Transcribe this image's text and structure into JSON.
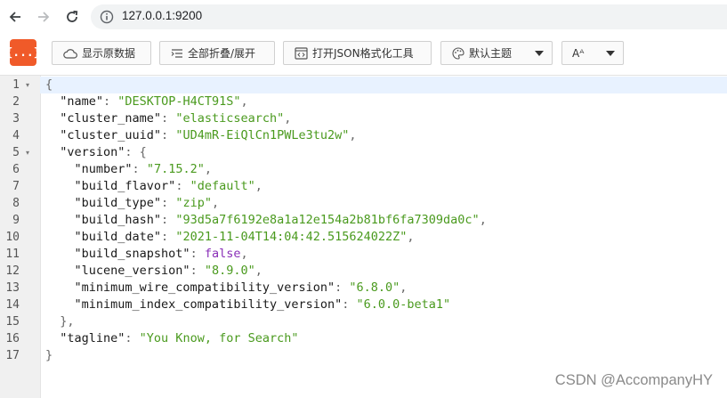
{
  "browser": {
    "url": "127.0.0.1:9200",
    "icons": [
      "arrow-left-icon",
      "arrow-right-icon",
      "reload-icon",
      "info-icon"
    ]
  },
  "toolbar": {
    "logo_text": "{...}",
    "show_raw_label": "显示原数据",
    "fold_all_label": "全部折叠/展开",
    "open_tool_label": "打开JSON格式化工具",
    "theme_label": "默认主题",
    "font_label": "Aᴬ"
  },
  "code": {
    "lines": [
      {
        "n": "1",
        "fold": "▾",
        "tokens": [
          {
            "t": "{",
            "c": "p"
          }
        ]
      },
      {
        "n": "2",
        "tokens": [
          {
            "t": "  \"name\"",
            "c": "k"
          },
          {
            "t": ": ",
            "c": "p"
          },
          {
            "t": "\"DESKTOP-H4CT91S\"",
            "c": "s"
          },
          {
            "t": ",",
            "c": "p"
          }
        ]
      },
      {
        "n": "3",
        "tokens": [
          {
            "t": "  \"cluster_name\"",
            "c": "k"
          },
          {
            "t": ": ",
            "c": "p"
          },
          {
            "t": "\"elasticsearch\"",
            "c": "s"
          },
          {
            "t": ",",
            "c": "p"
          }
        ]
      },
      {
        "n": "4",
        "tokens": [
          {
            "t": "  \"cluster_uuid\"",
            "c": "k"
          },
          {
            "t": ": ",
            "c": "p"
          },
          {
            "t": "\"UD4mR-EiQlCn1PWLe3tu2w\"",
            "c": "s"
          },
          {
            "t": ",",
            "c": "p"
          }
        ]
      },
      {
        "n": "5",
        "fold": "▾",
        "tokens": [
          {
            "t": "  \"version\"",
            "c": "k"
          },
          {
            "t": ": {",
            "c": "p"
          }
        ]
      },
      {
        "n": "6",
        "tokens": [
          {
            "t": "    \"number\"",
            "c": "k"
          },
          {
            "t": ": ",
            "c": "p"
          },
          {
            "t": "\"7.15.2\"",
            "c": "s"
          },
          {
            "t": ",",
            "c": "p"
          }
        ]
      },
      {
        "n": "7",
        "tokens": [
          {
            "t": "    \"build_flavor\"",
            "c": "k"
          },
          {
            "t": ": ",
            "c": "p"
          },
          {
            "t": "\"default\"",
            "c": "s"
          },
          {
            "t": ",",
            "c": "p"
          }
        ]
      },
      {
        "n": "8",
        "tokens": [
          {
            "t": "    \"build_type\"",
            "c": "k"
          },
          {
            "t": ": ",
            "c": "p"
          },
          {
            "t": "\"zip\"",
            "c": "s"
          },
          {
            "t": ",",
            "c": "p"
          }
        ]
      },
      {
        "n": "9",
        "tokens": [
          {
            "t": "    \"build_hash\"",
            "c": "k"
          },
          {
            "t": ": ",
            "c": "p"
          },
          {
            "t": "\"93d5a7f6192e8a1a12e154a2b81bf6fa7309da0c\"",
            "c": "s"
          },
          {
            "t": ",",
            "c": "p"
          }
        ]
      },
      {
        "n": "10",
        "tokens": [
          {
            "t": "    \"build_date\"",
            "c": "k"
          },
          {
            "t": ": ",
            "c": "p"
          },
          {
            "t": "\"2021-11-04T14:04:42.515624022Z\"",
            "c": "s"
          },
          {
            "t": ",",
            "c": "p"
          }
        ]
      },
      {
        "n": "11",
        "tokens": [
          {
            "t": "    \"build_snapshot\"",
            "c": "k"
          },
          {
            "t": ": ",
            "c": "p"
          },
          {
            "t": "false",
            "c": "b"
          },
          {
            "t": ",",
            "c": "p"
          }
        ]
      },
      {
        "n": "12",
        "tokens": [
          {
            "t": "    \"lucene_version\"",
            "c": "k"
          },
          {
            "t": ": ",
            "c": "p"
          },
          {
            "t": "\"8.9.0\"",
            "c": "s"
          },
          {
            "t": ",",
            "c": "p"
          }
        ]
      },
      {
        "n": "13",
        "tokens": [
          {
            "t": "    \"minimum_wire_compatibility_version\"",
            "c": "k"
          },
          {
            "t": ": ",
            "c": "p"
          },
          {
            "t": "\"6.8.0\"",
            "c": "s"
          },
          {
            "t": ",",
            "c": "p"
          }
        ]
      },
      {
        "n": "14",
        "tokens": [
          {
            "t": "    \"minimum_index_compatibility_version\"",
            "c": "k"
          },
          {
            "t": ": ",
            "c": "p"
          },
          {
            "t": "\"6.0.0-beta1\"",
            "c": "s"
          }
        ]
      },
      {
        "n": "15",
        "tokens": [
          {
            "t": "  },",
            "c": "p"
          }
        ]
      },
      {
        "n": "16",
        "tokens": [
          {
            "t": "  \"tagline\"",
            "c": "k"
          },
          {
            "t": ": ",
            "c": "p"
          },
          {
            "t": "\"You Know, for Search\"",
            "c": "s"
          }
        ]
      },
      {
        "n": "17",
        "tokens": [
          {
            "t": "}",
            "c": "p"
          }
        ]
      }
    ]
  },
  "watermark": "CSDN @AccompanyHY",
  "colors": {
    "logo": "#f05a29",
    "key": "#1a1a1a",
    "string": "#4a9a1e",
    "boolean": "#8a2fb8",
    "active_line": "#e8f2ff"
  }
}
